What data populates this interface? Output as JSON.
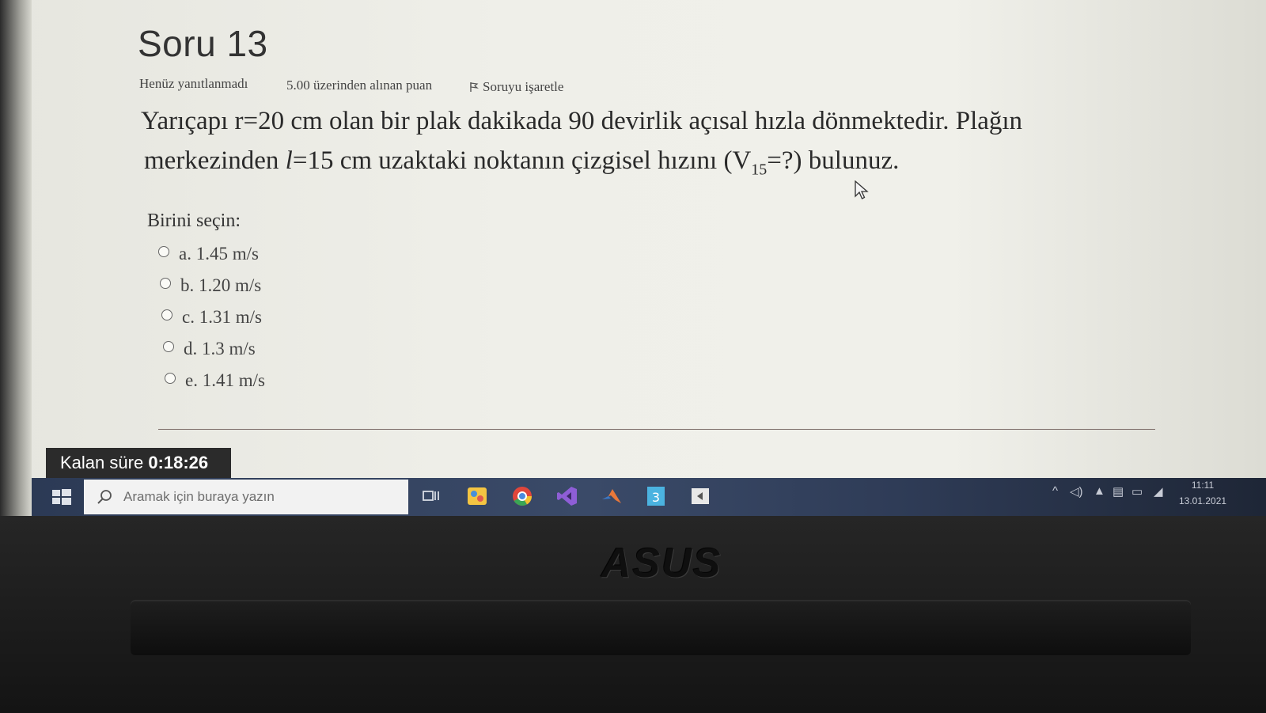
{
  "question": {
    "title": "Soru 13",
    "status": "Henüz yanıtlanmadı",
    "points": "5.00 üzerinden alınan puan",
    "flag_label": "Soruyu işaretle",
    "text_line1": "Yarıçapı r=20 cm olan bir plak dakikada 90 devirlik açısal hızla dönmektedir. Plağın",
    "text_line2_a": "merkezinden ",
    "text_line2_l": "l",
    "text_line2_b": "=15 cm  uzaktaki noktanın çizgisel hızını (V",
    "text_line2_sub": "15",
    "text_line2_c": "=?) bulunuz.",
    "choose_label": "Birini seçin:",
    "options": [
      {
        "label": "a. 1.45 m/s"
      },
      {
        "label": "b. 1.20 m/s"
      },
      {
        "label": "c. 1.31 m/s"
      },
      {
        "label": "d. 1.3 m/s"
      },
      {
        "label": "e. 1.41 m/s"
      }
    ]
  },
  "timer": {
    "label": "Kalan süre",
    "value": "0:18:26"
  },
  "taskbar": {
    "search_placeholder": "Aramak için buraya yazın",
    "icons": [
      "task-view-icon",
      "paint-icon",
      "chrome-icon",
      "visual-studio-icon",
      "matlab-icon",
      "app-3-icon",
      "media-icon"
    ],
    "time": "11:11",
    "date": "13.01.2021"
  },
  "laptop": {
    "brand": "ASUS"
  },
  "colors": {
    "screen_bg": "#efefe9",
    "timer_bg": "#2b2b2b",
    "taskbar_bg": "#2c3a55"
  }
}
